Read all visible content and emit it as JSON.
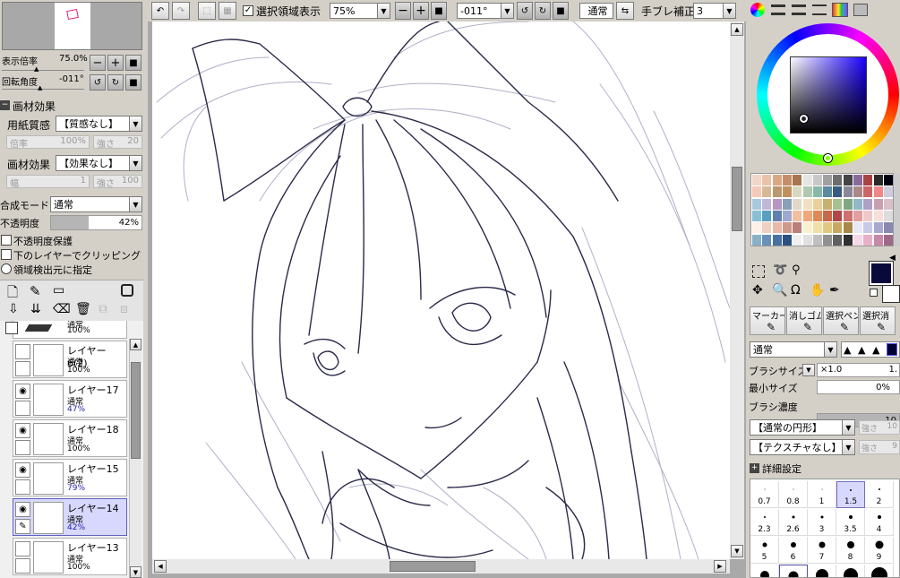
{
  "toolbar": {
    "selection_display_label": "選択領域表示",
    "zoom_value": "75%",
    "rotation_value": "-011°",
    "blend_value": "通常",
    "stabilizer_label": "手ブレ補正",
    "stabilizer_value": "3"
  },
  "navigator": {
    "zoom_label": "表示倍率",
    "zoom_value": "75.0%",
    "rotate_label": "回転角度",
    "rotate_value": "-011°"
  },
  "texture": {
    "section_label": "画材効果",
    "paper_label": "用紙質感",
    "paper_value": "【質感なし】",
    "paper_scale_label": "倍率",
    "paper_scale_value": "100%",
    "paper_strength_label": "強さ",
    "paper_strength_value": "20",
    "effect_label": "画材効果",
    "effect_value": "【効果なし】",
    "effect_width_label": "幅",
    "effect_width_value": "1",
    "effect_strength_label": "強さ",
    "effect_strength_value": "100"
  },
  "layer_props": {
    "blend_label": "合成モード",
    "blend_value": "通常",
    "opacity_label": "不透明度",
    "opacity_value": "42%",
    "opacity_fraction": 0.42,
    "preserve_opacity": "不透明度保護",
    "clip_below": "下のレイヤーでクリッピング",
    "selection_source": "領域検出元に指定"
  },
  "layers": {
    "partial_top": {
      "mode": "通常",
      "opacity": "100%"
    },
    "items": [
      {
        "name": "レイヤー6(2)",
        "mode": "通常",
        "opacity": "100%",
        "visible": false,
        "selected": false
      },
      {
        "name": "レイヤー17",
        "mode": "通常",
        "opacity": "47%",
        "visible": true,
        "selected": false
      },
      {
        "name": "レイヤー18",
        "mode": "通常",
        "opacity": "100%",
        "visible": true,
        "selected": false
      },
      {
        "name": "レイヤー15",
        "mode": "通常",
        "opacity": "79%",
        "visible": true,
        "selected": false
      },
      {
        "name": "レイヤー14",
        "mode": "通常",
        "opacity": "42%",
        "visible": true,
        "selected": true
      },
      {
        "name": "レイヤー13",
        "mode": "通常",
        "opacity": "100%",
        "visible": false,
        "selected": false
      }
    ]
  },
  "tools": {
    "labels": [
      "マーカー",
      "消しゴム",
      "選択ペン",
      "選択消"
    ]
  },
  "brush": {
    "blend_value": "通常",
    "size_label": "ブラシサイズ",
    "size_mult": "×1.0",
    "size_value": "1.",
    "min_size_label": "最小サイズ",
    "min_size_value": "0%",
    "density_label": "ブラシ濃度",
    "density_value": "10",
    "shape_value": "【通常の円形】",
    "shape_strength": "強さ",
    "shape_strength_value": "10",
    "texture_value": "【テクスチャなし】",
    "texture_strength": "強さ",
    "texture_strength_value": "9",
    "detail_label": "詳細設定",
    "sizes": [
      "0.7",
      "0.8",
      "1",
      "1.5",
      "2",
      "2.3",
      "2.6",
      "3",
      "3.5",
      "4",
      "5",
      "6",
      "7",
      "8",
      "9"
    ],
    "selected_size": "1.5"
  },
  "colors": {
    "accent": "#0a0a3a",
    "selected_layer": "#d8d8ff"
  }
}
